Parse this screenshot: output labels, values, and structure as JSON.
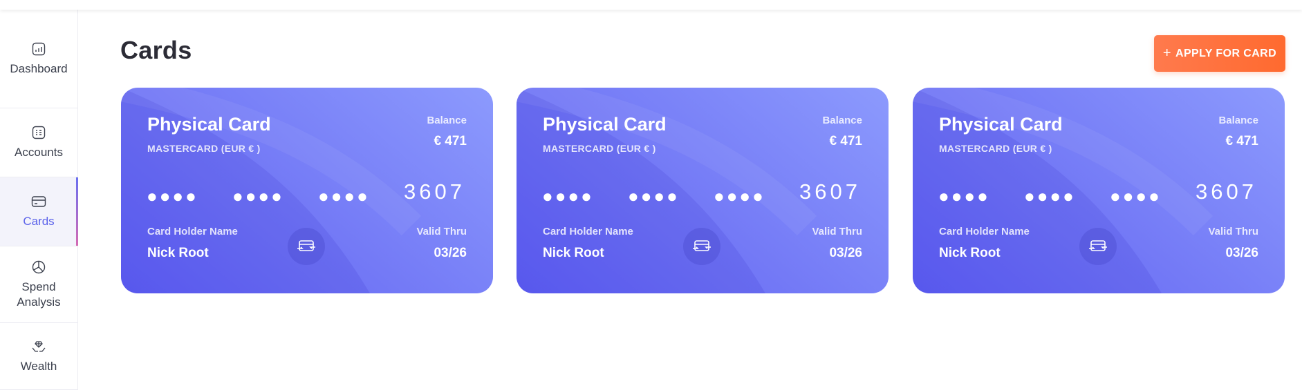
{
  "page": {
    "title": "Cards"
  },
  "header": {
    "apply_label": "APPLY FOR CARD",
    "apply_icon": "+"
  },
  "sidebar": {
    "items": [
      {
        "label": "Dashboard",
        "icon": "dashboard-icon",
        "active": false
      },
      {
        "label": "Accounts",
        "icon": "accounts-icon",
        "active": false
      },
      {
        "label": "Cards",
        "icon": "card-icon",
        "active": true
      },
      {
        "label": "Spend Analysis",
        "icon": "pie-chart-icon",
        "active": false
      },
      {
        "label": "Wealth",
        "icon": "wealth-icon",
        "active": false
      }
    ]
  },
  "colors": {
    "accent": "#5b62ea",
    "button": "#ff6a2f",
    "card_start": "#5e5ff3",
    "card_end": "#8c9afd"
  },
  "cards": [
    {
      "title": "Physical Card",
      "network": "MASTERCARD (EUR € )",
      "balance_label": "Balance",
      "balance_value": "€ 471",
      "masked_groups": [
        "●●●●",
        "●●●●",
        "●●●●"
      ],
      "last4": "3607",
      "holder_label": "Card Holder Name",
      "holder_name": "Nick Root",
      "valid_label": "Valid Thru",
      "valid_value": "03/26"
    },
    {
      "title": "Physical Card",
      "network": "MASTERCARD (EUR € )",
      "balance_label": "Balance",
      "balance_value": "€ 471",
      "masked_groups": [
        "●●●●",
        "●●●●",
        "●●●●"
      ],
      "last4": "3607",
      "holder_label": "Card Holder Name",
      "holder_name": "Nick Root",
      "valid_label": "Valid Thru",
      "valid_value": "03/26"
    },
    {
      "title": "Physical Card",
      "network": "MASTERCARD (EUR € )",
      "balance_label": "Balance",
      "balance_value": "€ 471",
      "masked_groups": [
        "●●●●",
        "●●●●",
        "●●●●"
      ],
      "last4": "3607",
      "holder_label": "Card Holder Name",
      "holder_name": "Nick Root",
      "valid_label": "Valid Thru",
      "valid_value": "03/26"
    }
  ]
}
